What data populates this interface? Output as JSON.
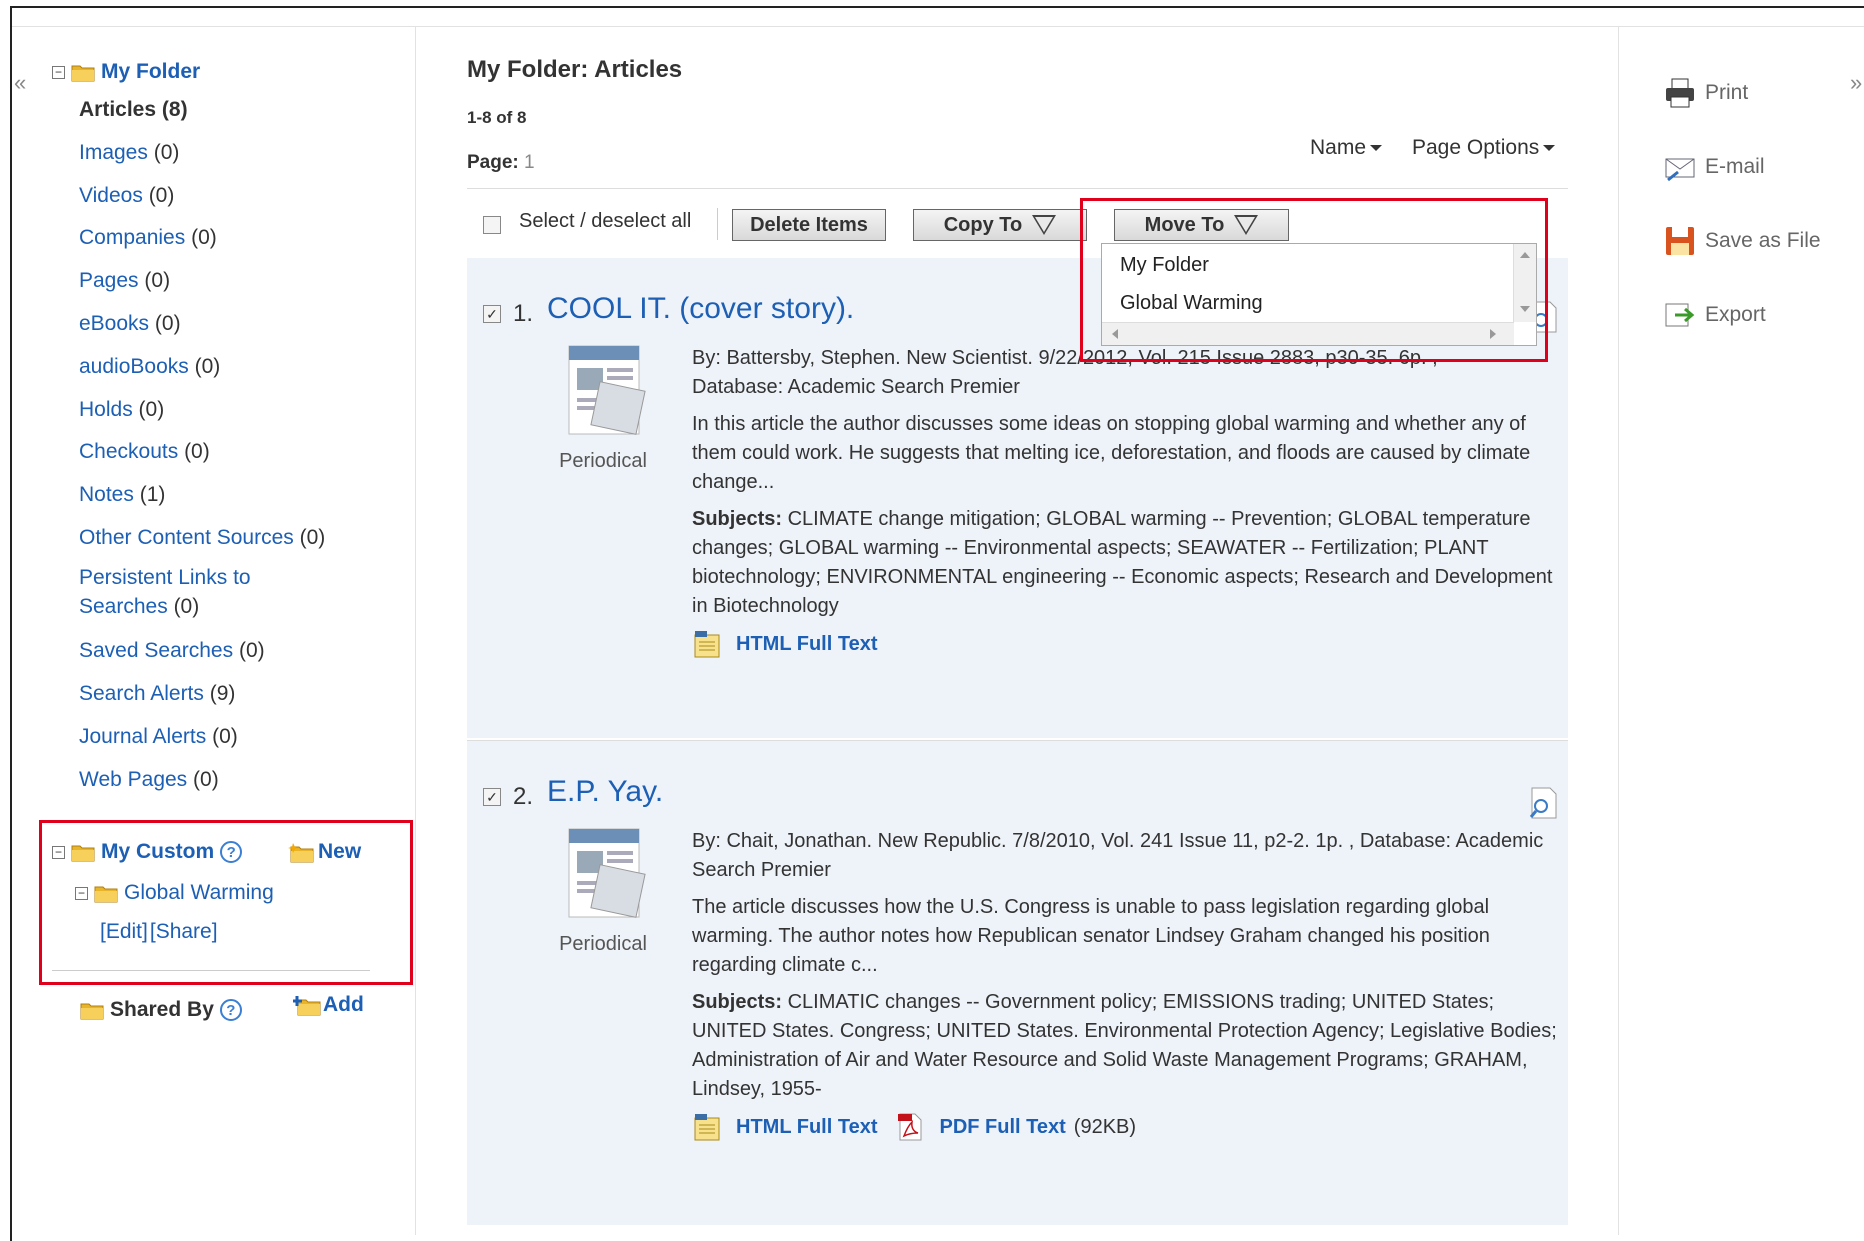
{
  "nav": {
    "collapse_left": "«",
    "collapse_right": "»"
  },
  "sidebar": {
    "root_label": "My Folder",
    "items": [
      {
        "label": "Articles",
        "count": "(8)"
      },
      {
        "label": "Images",
        "count": "(0)"
      },
      {
        "label": "Videos",
        "count": "(0)"
      },
      {
        "label": "Companies",
        "count": "(0)"
      },
      {
        "label": "Pages",
        "count": "(0)"
      },
      {
        "label": "eBooks",
        "count": "(0)"
      },
      {
        "label": "audioBooks",
        "count": "(0)"
      },
      {
        "label": "Holds",
        "count": "(0)"
      },
      {
        "label": "Checkouts",
        "count": "(0)"
      },
      {
        "label": "Notes",
        "count": "(1)"
      },
      {
        "label": "Other Content Sources",
        "count": "(0)"
      },
      {
        "label": "Persistent Links to",
        "label2": "Searches",
        "count": "(0)"
      },
      {
        "label": "Saved Searches",
        "count": "(0)"
      },
      {
        "label": "Search Alerts",
        "count": "(9)"
      },
      {
        "label": "Journal Alerts",
        "count": "(0)"
      },
      {
        "label": "Web Pages",
        "count": "(0)"
      }
    ],
    "custom": {
      "label": "My Custom",
      "help": "?",
      "new_label": "New",
      "subfolder": "Global Warming",
      "edit": "[Edit]",
      "share": "[Share]"
    },
    "shared": {
      "label": "Shared By",
      "help": "?",
      "add_label": "Add"
    }
  },
  "main": {
    "title": "My Folder: Articles",
    "range": "1-8 of 8",
    "page_label": "Page:",
    "page_value": "1",
    "sort_label": "Name",
    "page_options": "Page Options",
    "select_all": "Select / deselect all",
    "delete_items": "Delete Items",
    "copy_to": "Copy To",
    "move_to": "Move To",
    "move_options": [
      "My Folder",
      "Global Warming"
    ]
  },
  "results": [
    {
      "num": "1.",
      "title": "COOL IT. (cover story).",
      "type": "Periodical",
      "byline": "By: Battersby, Stephen. New Scientist. 9/22/2012, Vol. 215 Issue 2883, p30-35. 6p. ,",
      "database": "Database: Academic Search Premier",
      "abstract": "In this article the author discusses some ideas on stopping global warming and whether any of them could work. He suggests that melting ice, deforestation, and floods are caused by climate change...",
      "subjects_label": "Subjects:",
      "subjects": "CLIMATE change mitigation; GLOBAL warming -- Prevention; GLOBAL temperature changes; GLOBAL warming -- Environmental aspects; SEAWATER -- Fertilization; PLANT biotechnology; ENVIRONMENTAL engineering -- Economic aspects; Research and Development in Biotechnology",
      "html_full_text": "HTML Full Text"
    },
    {
      "num": "2.",
      "title": "E.P. Yay.",
      "type": "Periodical",
      "byline": "By: Chait, Jonathan. New Republic. 7/8/2010, Vol. 241 Issue 11, p2-2. 1p. , Database: Academic Search Premier",
      "abstract": "The article discusses how the U.S. Congress is unable to pass legislation regarding global warming. The author notes how Republican senator Lindsey Graham changed his position regarding climate c...",
      "subjects_label": "Subjects:",
      "subjects": "CLIMATIC changes -- Government policy; EMISSIONS trading; UNITED States; UNITED States. Congress; UNITED States. Environmental Protection Agency; Legislative Bodies; Administration of Air and Water Resource and Solid Waste Management Programs; GRAHAM, Lindsey, 1955-",
      "html_full_text": "HTML Full Text",
      "pdf_full_text": "PDF Full Text",
      "pdf_size": "(92KB)"
    }
  ],
  "tools": {
    "print": "Print",
    "email": "E-mail",
    "save": "Save as File",
    "export": "Export"
  },
  "colors": {
    "link": "#1c5fb4",
    "highlight_box": "#e0001b",
    "result_bg": "#eef3f9"
  }
}
